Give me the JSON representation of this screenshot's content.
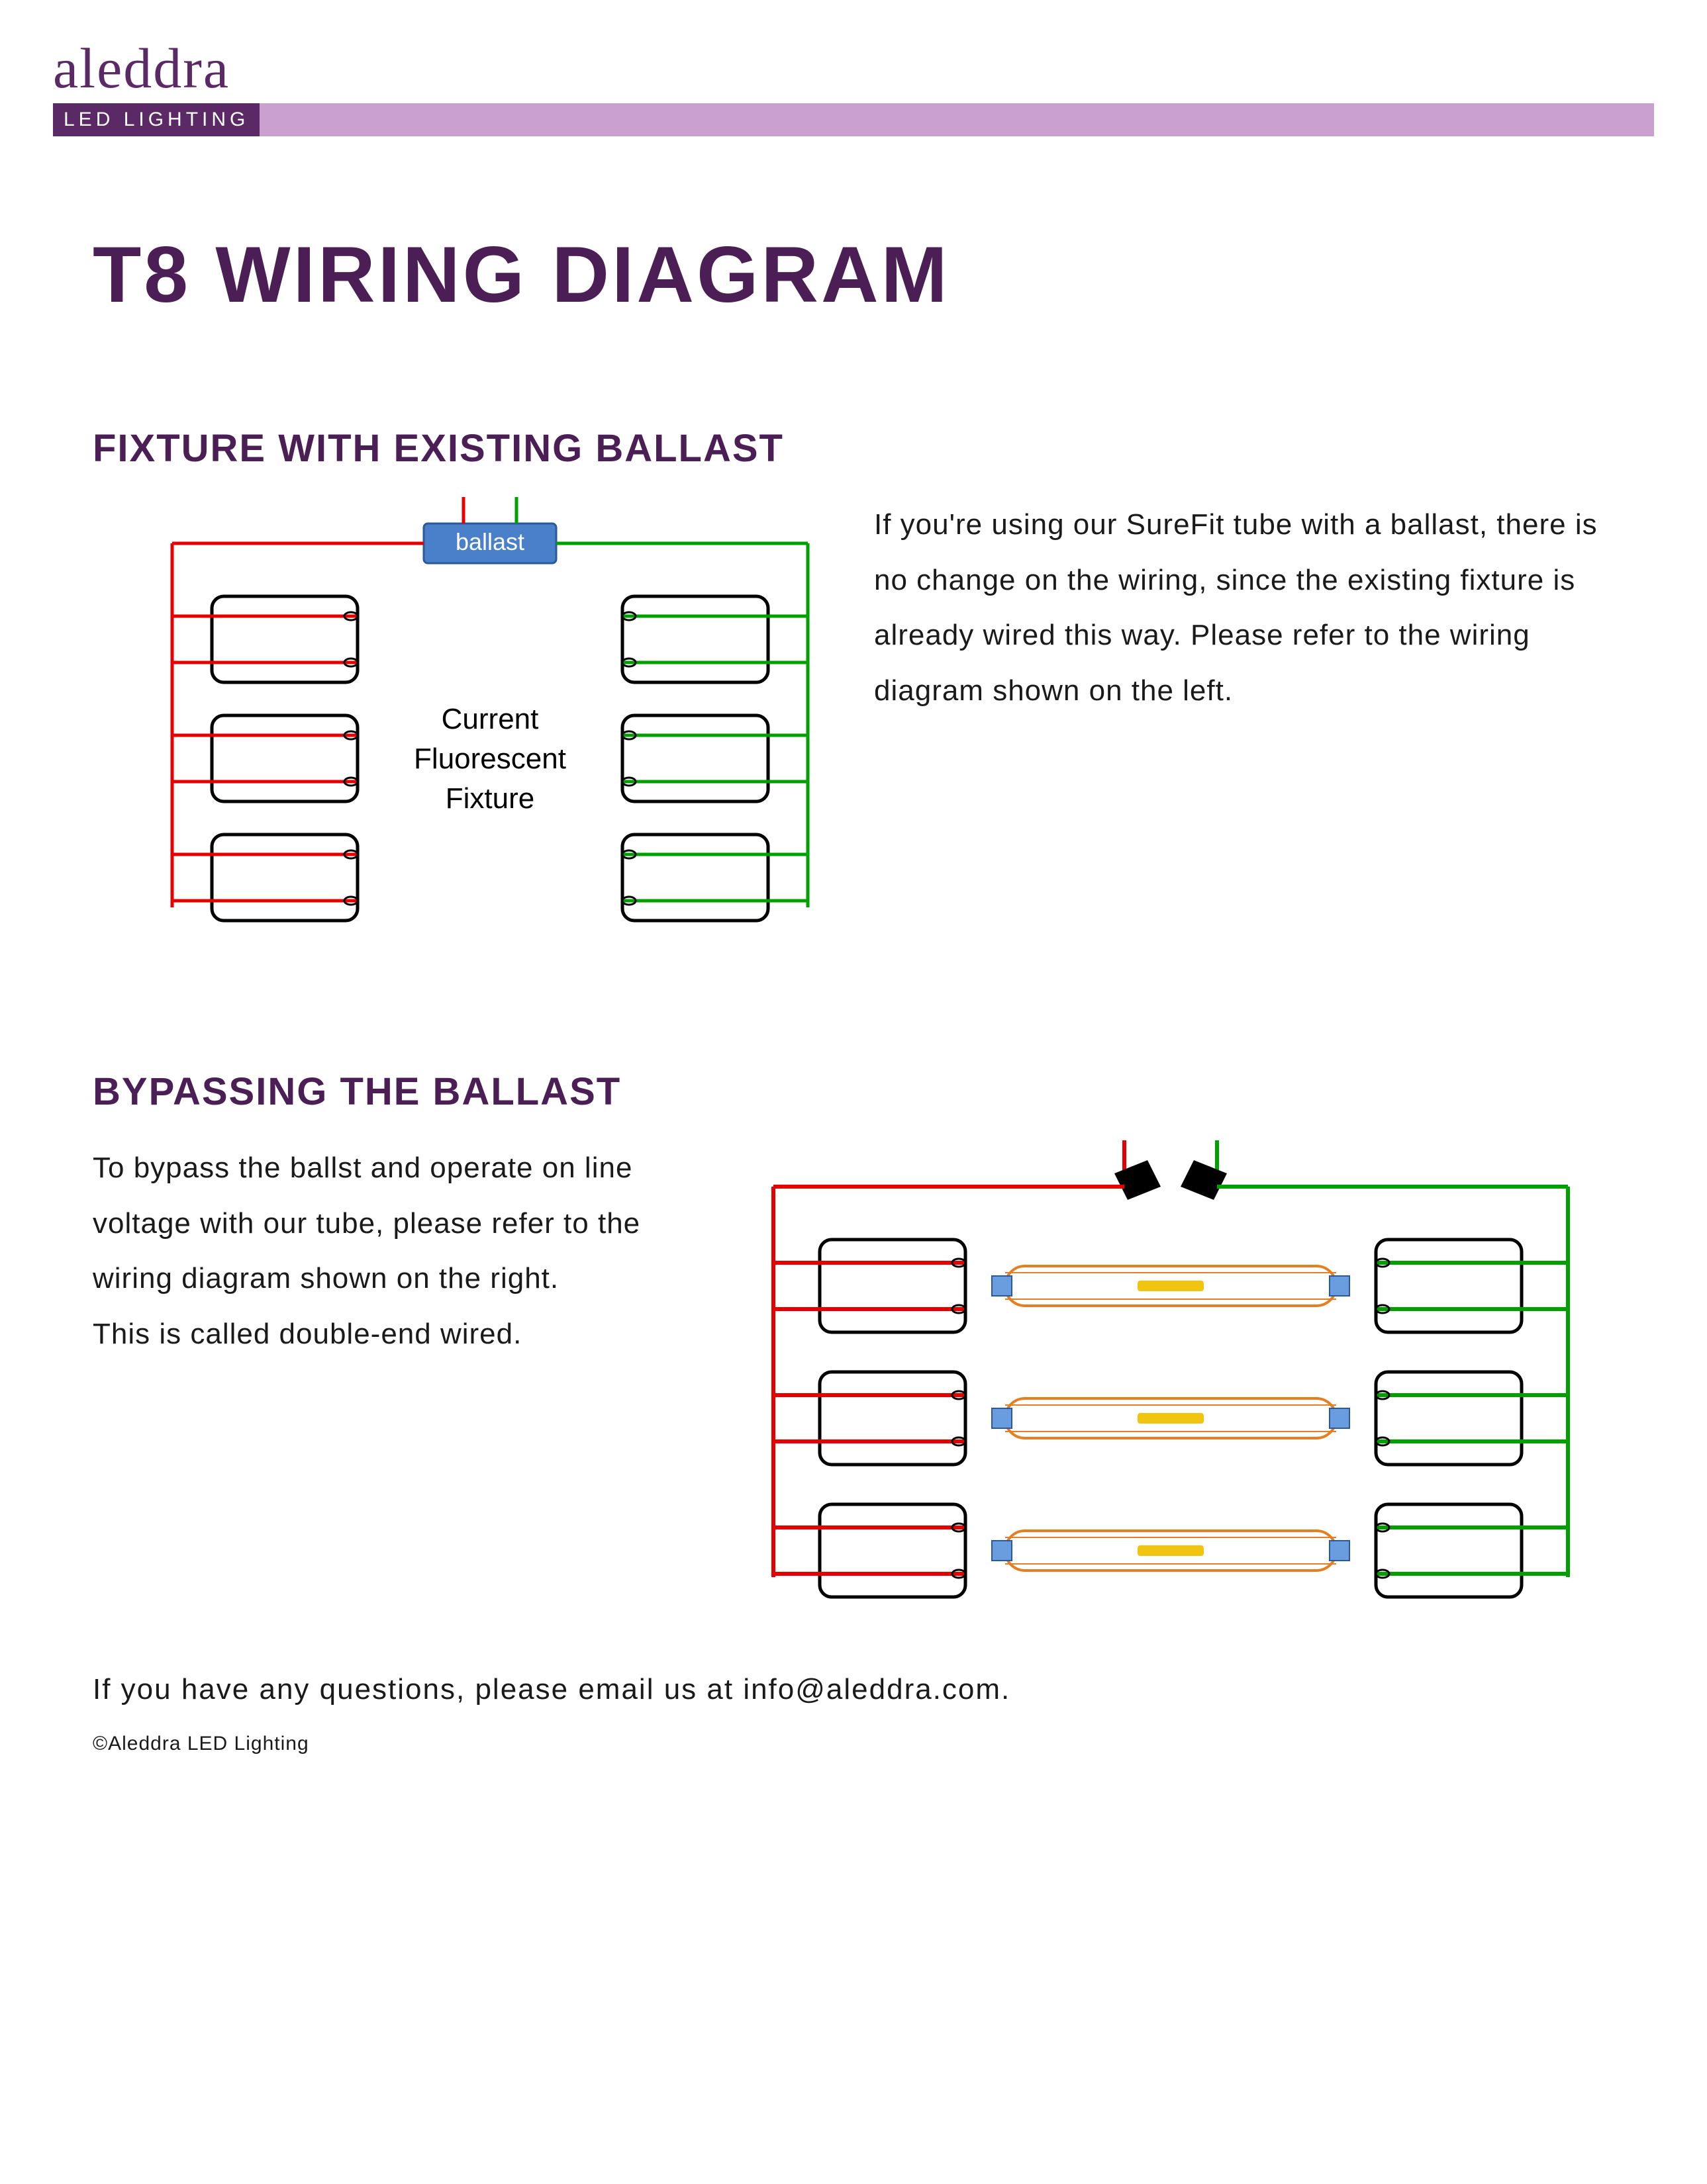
{
  "brand": {
    "name": "aleddra",
    "sub": "LED LIGHTING"
  },
  "page_title": "T8 WIRING DIAGRAM",
  "section1": {
    "title": "FIXTURE WITH EXISTING BALLAST",
    "text": "If you're using our SureFit tube with a ballast, there is no change on the wiring, since the existing fixture is already wired this way. Please refer to the wiring diagram shown on the left.",
    "diagram_label_center": "Current Fluorescent Fixture",
    "ballast_label": "ballast"
  },
  "section2": {
    "title": "BYPASSING THE BALLAST",
    "text": "To bypass the ballst and operate on line voltage with our tube, please refer to the wiring diagram shown on the right.\nThis is called double-end wired."
  },
  "footer": {
    "question": "If you have any questions, please email us at info@aleddra.com.",
    "copyright": "©Aleddra LED Lighting"
  },
  "colors": {
    "purple": "#4b1f56",
    "lavender": "#c9a0ce",
    "wire_red": "#e60000",
    "wire_green": "#00a000",
    "ballast_blue": "#4a7fc9"
  }
}
